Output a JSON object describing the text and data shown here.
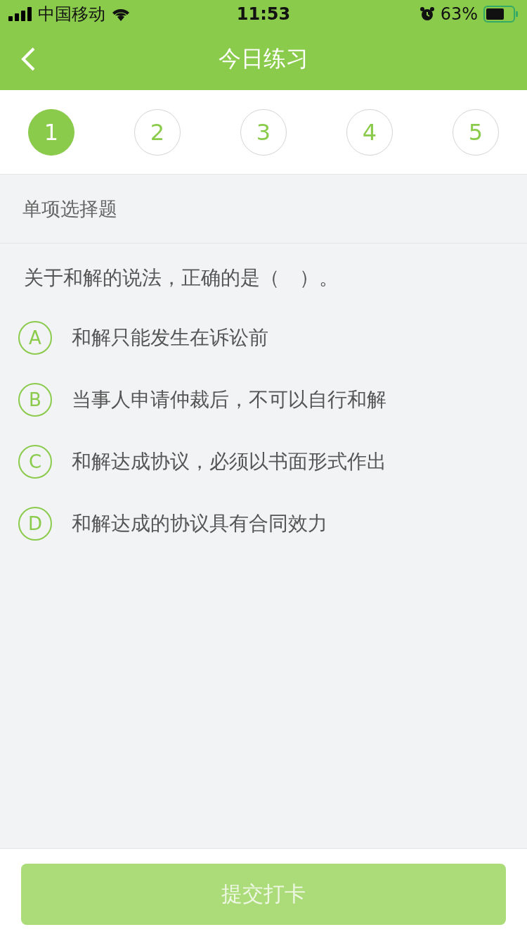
{
  "status_bar": {
    "carrier": "中国移动",
    "time": "11:53",
    "battery": "63%"
  },
  "nav": {
    "title": "今日练习"
  },
  "steps": [
    {
      "label": "1",
      "selected": true
    },
    {
      "label": "2",
      "selected": false
    },
    {
      "label": "3",
      "selected": false
    },
    {
      "label": "4",
      "selected": false
    },
    {
      "label": "5",
      "selected": false
    }
  ],
  "section": {
    "title": "单项选择题"
  },
  "question": {
    "text": "关于和解的说法，正确的是（　）。",
    "options": [
      {
        "letter": "A",
        "text": "和解只能发生在诉讼前",
        "selected": false
      },
      {
        "letter": "B",
        "text": "当事人申请仲裁后，不可以自行和解",
        "selected": false
      },
      {
        "letter": "C",
        "text": "和解达成协议，必须以书面形式作出",
        "selected": false
      },
      {
        "letter": "D",
        "text": "和解达成的协议具有合同效力",
        "selected": false
      }
    ]
  },
  "submit": {
    "label": "提交打卡",
    "disabled": true
  }
}
